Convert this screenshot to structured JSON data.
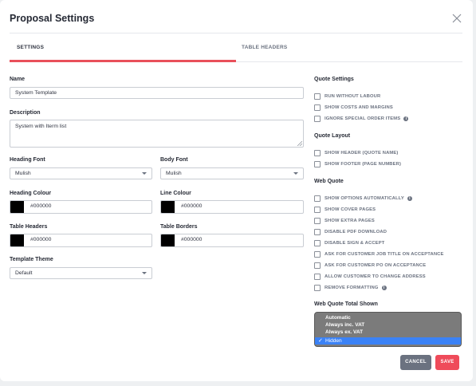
{
  "header": {
    "title": "Proposal Settings",
    "close_icon": "close-icon"
  },
  "tabs": [
    {
      "label": "SETTINGS",
      "active": true
    },
    {
      "label": "TABLE HEADERS",
      "active": false
    }
  ],
  "form": {
    "name": {
      "label": "Name",
      "value": "System Template"
    },
    "description": {
      "label": "Description",
      "value": "System with Iterm list"
    },
    "heading_font": {
      "label": "Heading Font",
      "value": "Mulish"
    },
    "body_font": {
      "label": "Body Font",
      "value": "Mulish"
    },
    "heading_colour": {
      "label": "Heading Colour",
      "value": "#000000"
    },
    "line_colour": {
      "label": "Line Colour",
      "value": "#000000"
    },
    "table_headers": {
      "label": "Table Headers",
      "value": "#000000"
    },
    "table_borders": {
      "label": "Table Borders",
      "value": "#000000"
    },
    "template_theme": {
      "label": "Template Theme",
      "value": "Default"
    }
  },
  "quote_settings": {
    "title": "Quote Settings",
    "items": [
      {
        "label": "RUN WITHOUT LABOUR",
        "checked": false,
        "info": false
      },
      {
        "label": "SHOW COSTS AND MARGINS",
        "checked": false,
        "info": false
      },
      {
        "label": "IGNORE SPECIAL ORDER ITEMS",
        "checked": false,
        "info": true
      }
    ]
  },
  "quote_layout": {
    "title": "Quote Layout",
    "items": [
      {
        "label": "SHOW HEADER (QUOTE NAME)",
        "checked": false
      },
      {
        "label": "SHOW FOOTER (PAGE NUMBER)",
        "checked": false
      }
    ]
  },
  "web_quote": {
    "title": "Web Quote",
    "items": [
      {
        "label": "SHOW OPTIONS AUTOMATICALLY",
        "checked": false,
        "info": true
      },
      {
        "label": "SHOW COVER PAGES",
        "checked": false,
        "info": false
      },
      {
        "label": "SHOW EXTRA PAGES",
        "checked": false,
        "info": false
      },
      {
        "label": "DISABLE PDF DOWNLOAD",
        "checked": false,
        "info": false
      },
      {
        "label": "DISABLE SIGN & ACCEPT",
        "checked": false,
        "info": false
      },
      {
        "label": "ASK FOR CUSTOMER JOB TITLE ON ACCEPTANCE",
        "checked": false,
        "info": false
      },
      {
        "label": "ASK FOR CUSTOMER PO ON ACCEPTANCE",
        "checked": false,
        "info": false
      },
      {
        "label": "ALLOW CUSTOMER TO CHANGE ADDRESS",
        "checked": false,
        "info": false
      },
      {
        "label": "REMOVE FORMATTING",
        "checked": false,
        "info": true
      }
    ]
  },
  "web_quote_total": {
    "title": "Web Quote Total Shown",
    "options": [
      "Automatic",
      "Always inc. VAT",
      "Always ex. VAT",
      "Hidden"
    ],
    "selected": "Hidden",
    "check_glyph": "✓"
  },
  "buttons": {
    "cancel": "CANCEL",
    "save": "SAVE"
  },
  "colors": {
    "accent": "#e9505a",
    "save": "#ef4b5a",
    "cancel": "#6b7280",
    "selected_option": "#3b82f6"
  }
}
